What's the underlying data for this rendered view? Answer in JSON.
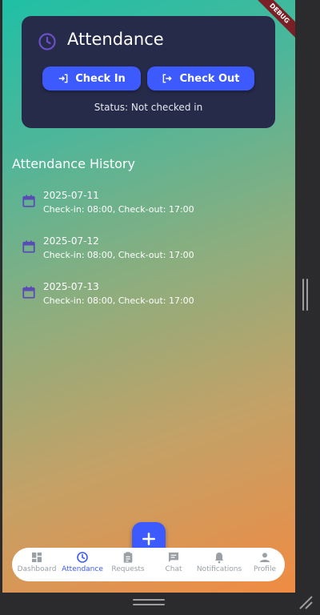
{
  "debug_banner": "DEBUG",
  "attendance_card": {
    "title": "Attendance",
    "check_in_label": "Check In",
    "check_out_label": "Check Out",
    "status_text": "Status: Not checked in"
  },
  "history": {
    "title": "Attendance History",
    "items": [
      {
        "date": "2025-07-11",
        "detail": "Check-in: 08:00, Check-out: 17:00"
      },
      {
        "date": "2025-07-12",
        "detail": "Check-in: 08:00, Check-out: 17:00"
      },
      {
        "date": "2025-07-13",
        "detail": "Check-in: 08:00, Check-out: 17:00"
      }
    ]
  },
  "fab": {
    "icon": "plus-icon"
  },
  "bottom_nav": {
    "items": [
      {
        "label": "Dashboard",
        "icon": "dashboard-icon",
        "active": false
      },
      {
        "label": "Attendance",
        "icon": "clock-icon",
        "active": true
      },
      {
        "label": "Requests",
        "icon": "clipboard-icon",
        "active": false
      },
      {
        "label": "Chat",
        "icon": "chat-icon",
        "active": false
      },
      {
        "label": "Notifications",
        "icon": "bell-icon",
        "active": false
      },
      {
        "label": "Profile",
        "icon": "person-icon",
        "active": false
      }
    ]
  },
  "colors": {
    "accent": "#3d5afe",
    "card_bg": "#272b4a",
    "calendar_icon": "#5b4bb4",
    "inactive_nav": "#9aa0a6"
  }
}
